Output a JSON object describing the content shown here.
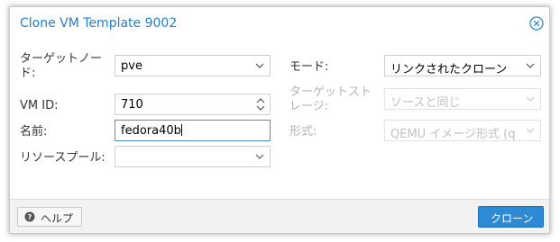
{
  "dialog": {
    "title": "Clone VM Template 9002",
    "close_icon": "close-circle-icon"
  },
  "form": {
    "target_node": {
      "label_line1": "ターゲットノー",
      "label_line2": "ド:",
      "value": "pve"
    },
    "vm_id": {
      "label": "VM ID:",
      "value": "710"
    },
    "name": {
      "label": "名前:",
      "value": "fedora40b"
    },
    "resource_pool": {
      "label": "リソースプール:",
      "value": ""
    },
    "mode": {
      "label": "モード:",
      "value": "リンクされたクローン"
    },
    "target_storage": {
      "label_line1": "ターゲットスト",
      "label_line2": "レージ:",
      "value": "ソースと同じ"
    },
    "format": {
      "label": "形式:",
      "value": "QEMU イメージ形式 (q"
    }
  },
  "footer": {
    "help_label": "ヘルプ",
    "help_icon": "question-circle-icon",
    "clone_label": "クローン"
  },
  "colors": {
    "accent": "#2e8ad4",
    "title": "#1f7fce"
  }
}
